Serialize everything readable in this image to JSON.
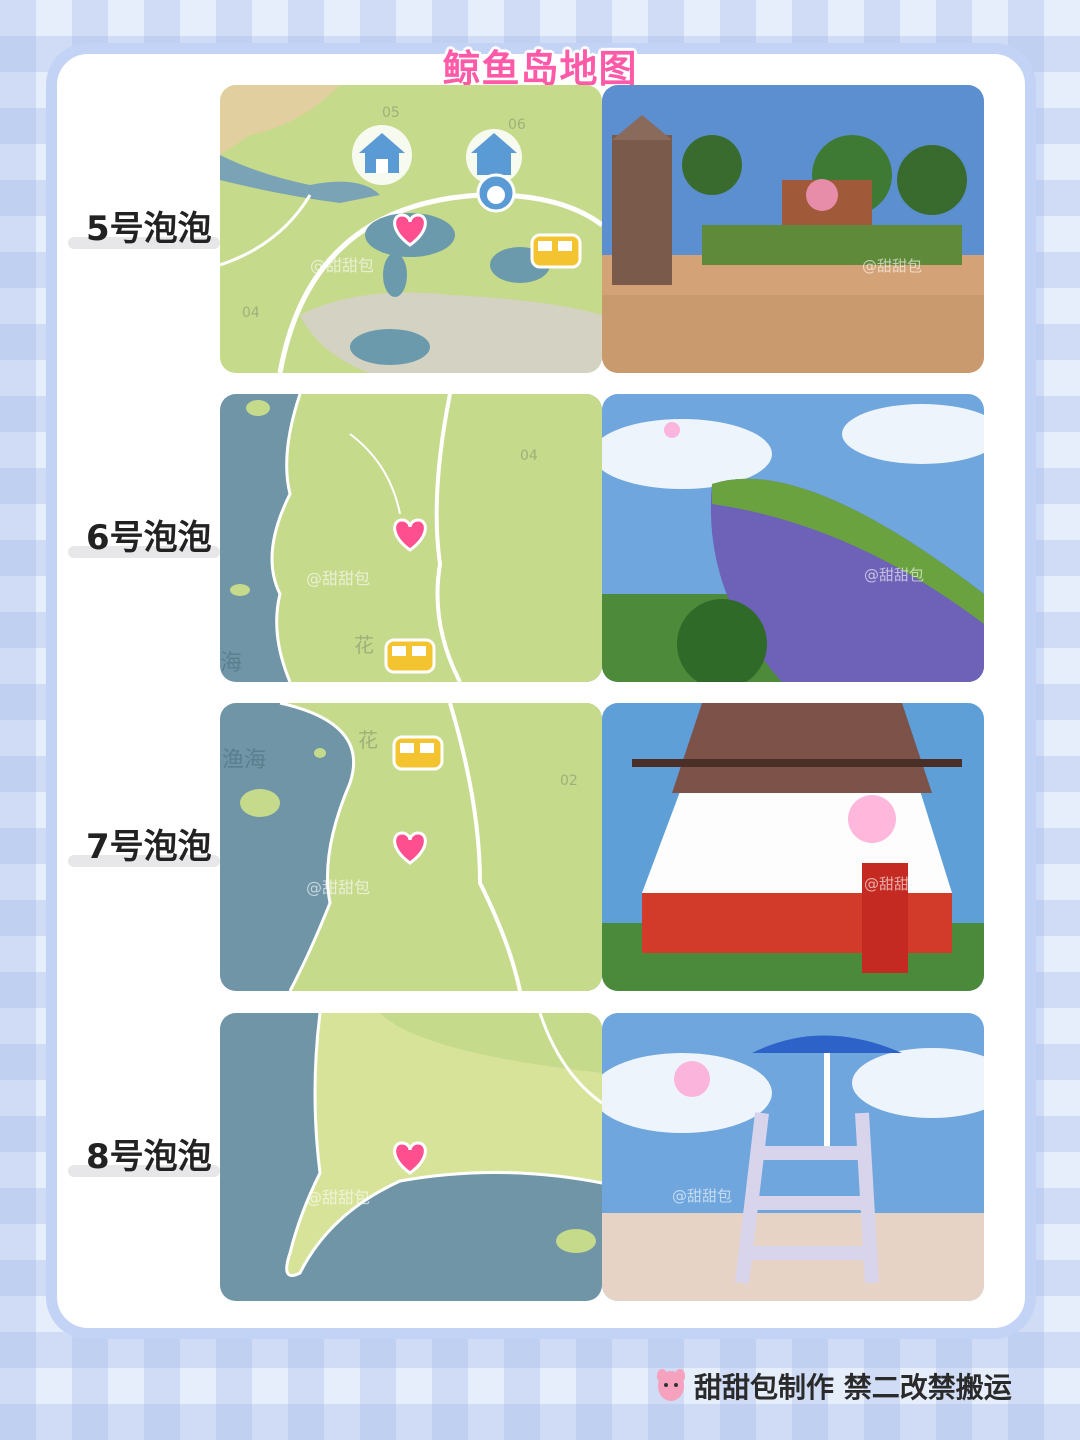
{
  "title": "鲸鱼岛地图",
  "colors": {
    "title": "#ff5aa8",
    "heart": "#ff4f8e",
    "land": "#c4d98a",
    "sea": "#6f95a6",
    "bus": "#f4c430"
  },
  "rows": [
    {
      "label": "5号泡泡",
      "map_sea_label": "",
      "map_numbers": [
        "05",
        "06",
        "04"
      ],
      "watermark": "@甜甜包",
      "icons": [
        "house-icon",
        "house-icon",
        "bunny-icon",
        "bus-icon",
        "heart-icon"
      ],
      "scene": "wooden dock with trees and a pink bubble"
    },
    {
      "label": "6号泡泡",
      "map_sea_label": "海",
      "map_area_label": "花",
      "map_numbers": [
        "04"
      ],
      "watermark": "@甜甜包",
      "icons": [
        "bus-icon",
        "heart-icon"
      ],
      "scene": "whale-shaped grassy rock"
    },
    {
      "label": "7号泡泡",
      "map_sea_label": "渔海",
      "map_area_label": "花",
      "map_numbers": [
        "02"
      ],
      "watermark": "@甜甜包",
      "icons": [
        "bus-icon",
        "heart-icon"
      ],
      "scene": "red and white lighthouse with bubble"
    },
    {
      "label": "8号泡泡",
      "map_sea_label": "",
      "map_numbers": [],
      "watermark": "@甜甜包",
      "icons": [
        "heart-icon"
      ],
      "scene": "lifeguard tower with umbrella on beach"
    }
  ],
  "footer": {
    "text": "甜甜包制作 禁二改禁搬运",
    "logo_icon": "pink-mascot-icon"
  }
}
